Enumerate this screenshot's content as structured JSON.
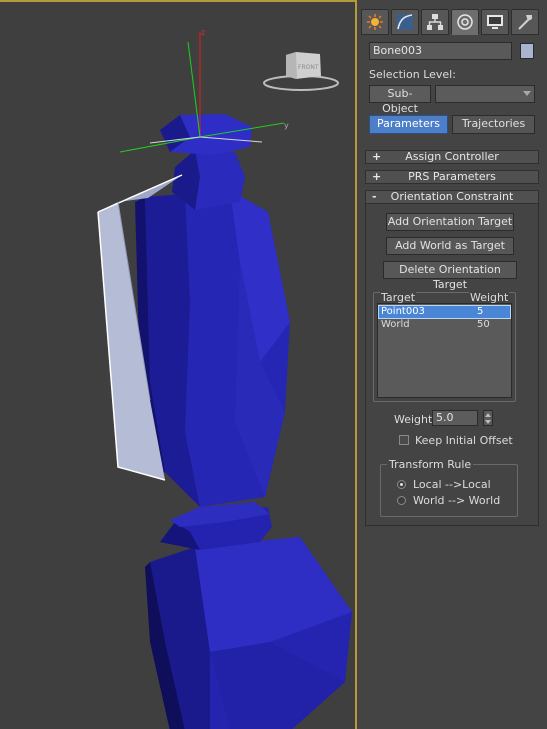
{
  "viewport": {
    "viewcube_label": "FRONT",
    "axis_z": "z",
    "axis_y": "y"
  },
  "panel": {
    "tabs": [
      {
        "icon": "create-icon"
      },
      {
        "icon": "modify-icon"
      },
      {
        "icon": "hierarchy-icon"
      },
      {
        "icon": "motion-icon",
        "active": true
      },
      {
        "icon": "display-icon"
      },
      {
        "icon": "utilities-icon"
      }
    ],
    "object_name": "Bone003",
    "swatch_color": "#a9b4d0",
    "selection_level_label": "Selection Level:",
    "subobject_label": "Sub-Object",
    "subobject_value": "",
    "tab_parameters": "Parameters",
    "tab_trajectories": "Trajectories",
    "rollouts": {
      "assign_sign": "+",
      "assign_label": "Assign Controller",
      "prs_sign": "+",
      "prs_label": "PRS Parameters",
      "orient_sign": "-",
      "orient_label": "Orientation Constraint"
    },
    "orientation": {
      "add_orient_target": "Add Orientation Target",
      "add_world_target": "Add World as Target",
      "delete_orient_target": "Delete Orientation Target",
      "col_target": "Target",
      "col_weight": "Weight",
      "targets": [
        {
          "target": "Point003",
          "weight": "5",
          "selected": true
        },
        {
          "target": "World",
          "weight": "50",
          "selected": false
        }
      ],
      "weight_label": "Weight",
      "weight_value": "5.0",
      "keep_initial_offset": "Keep Initial Offset",
      "keep_initial_offset_checked": false,
      "transform_rule_label": "Transform Rule",
      "rule_local": "Local -->Local",
      "rule_world": "World --> World",
      "selected_rule": "local"
    }
  },
  "colors": {
    "viewport_bg": "#3f3f3f",
    "viewport_border": "#b59a3a",
    "bone_blue": "#2a2ab8",
    "accent_blue": "#4d7fc8"
  }
}
